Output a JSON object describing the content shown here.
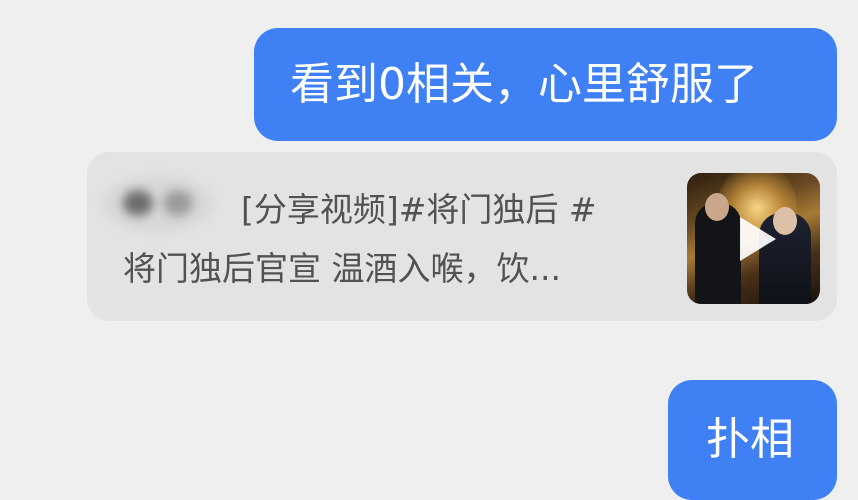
{
  "messages": [
    {
      "text": "看到0相关，心里舒服了"
    },
    {
      "text": "扑相"
    }
  ],
  "share_card": {
    "line1": "[分享视频]#将门独后 #",
    "line2": "将门独后官宣 温酒入喉，饮..."
  },
  "colors": {
    "outgoing_bubble": "#3f80f4",
    "card_background": "#e3e3e3",
    "page_background": "#efefef"
  }
}
